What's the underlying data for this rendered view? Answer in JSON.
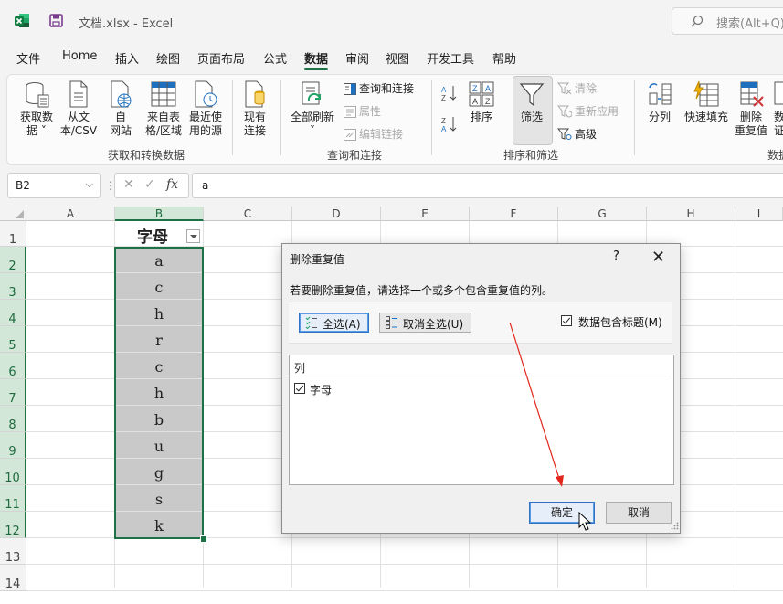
{
  "titlebar": {
    "doc_title": "文档.xlsx  -  Excel",
    "search_placeholder": "搜索(Alt+Q)"
  },
  "menu": {
    "tabs": [
      "文件",
      "Home",
      "插入",
      "绘图",
      "页面布局",
      "公式",
      "数据",
      "审阅",
      "视图",
      "开发工具",
      "帮助"
    ],
    "active": "数据"
  },
  "ribbon": {
    "get_data": [
      "获取数",
      "据 ˅"
    ],
    "from_text": [
      "从文",
      "本/CSV"
    ],
    "from_web": [
      "自",
      "网站"
    ],
    "from_table": [
      "来自表",
      "格/区域"
    ],
    "recent": [
      "最近使",
      "用的源"
    ],
    "existing": [
      "现有",
      "连接"
    ],
    "group1": "获取和转换数据",
    "refresh_all": [
      "全部刷新",
      "˅"
    ],
    "queries": "查询和连接",
    "properties": "属性",
    "edit_links": "编辑链接",
    "group2": "查询和连接",
    "sort": "排序",
    "filter": "筛选",
    "clear": "清除",
    "reapply": "重新应用",
    "advanced": "高级",
    "group3": "排序和筛选",
    "split": "分列",
    "flash_fill": "快速填充",
    "remove_dup": [
      "删除",
      "重复值"
    ],
    "data_v": [
      "数",
      "证"
    ],
    "group4": "数据"
  },
  "formula_bar": {
    "name_box": "B2",
    "fx": "fx",
    "value": "a"
  },
  "grid": {
    "columns": [
      "A",
      "B",
      "C",
      "D",
      "E",
      "F",
      "G",
      "H",
      "I"
    ],
    "rows": [
      "1",
      "2",
      "3",
      "4",
      "5",
      "6",
      "7",
      "8",
      "9",
      "10",
      "11",
      "12",
      "13",
      "14"
    ],
    "header": "字母",
    "values": [
      "a",
      "c",
      "h",
      "r",
      "c",
      "h",
      "b",
      "u",
      "g",
      "s",
      "k"
    ]
  },
  "dialog": {
    "title": "删除重复值",
    "help": "?",
    "prompt": "若要删除重复值，请选择一个或多个包含重复值的列。",
    "select_all": "全选(A)",
    "unselect_all": "取消全选(U)",
    "has_headers": "数据包含标题(M)",
    "list_header": "列",
    "list_items": [
      "字母"
    ],
    "ok": "确定",
    "cancel": "取消"
  },
  "colors": {
    "excel_green": "#1e7145",
    "selection_fill": "#c9c9c9",
    "annotation_arrow": "#e3261c"
  }
}
